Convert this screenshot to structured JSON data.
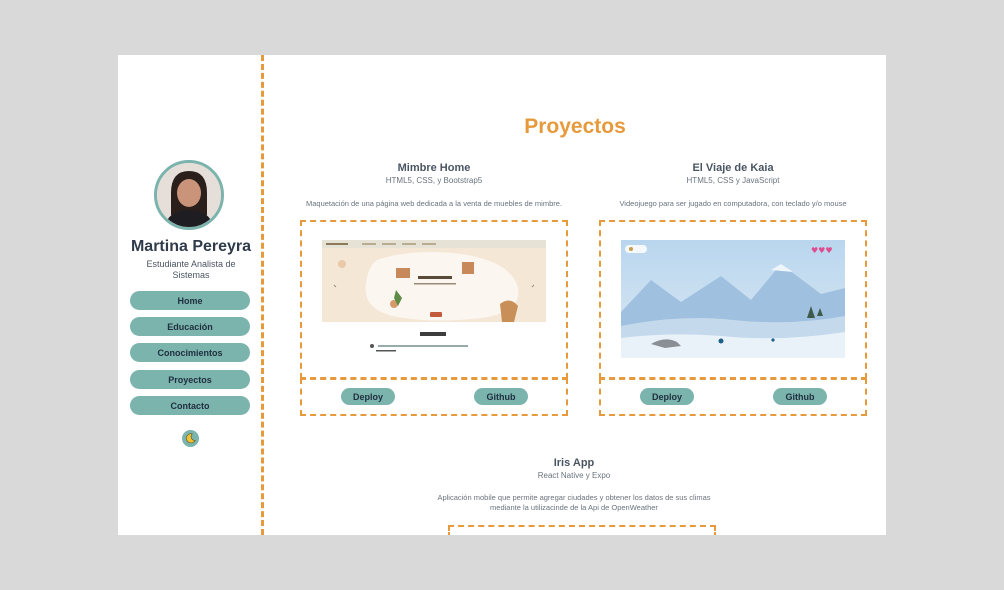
{
  "profile": {
    "name": "Martina Pereyra",
    "subtitle": "Estudiante Analista de Sistemas"
  },
  "nav": {
    "items": [
      "Home",
      "Educación",
      "Conocimientos",
      "Proyectos",
      "Contacto"
    ]
  },
  "theme_toggle": {
    "icon": "moon-icon"
  },
  "section": {
    "title": "Proyectos"
  },
  "projects": [
    {
      "title": "Mimbre Home",
      "tech": "HTML5, CSS, y Bootstrap5",
      "desc": "Maquetación de una página web dedicada a la venta de muebles de mimbre.",
      "preview": {
        "brand": "MIMBRE HOME",
        "heading": "Productos"
      },
      "deploy_label": "Deploy",
      "github_label": "Github"
    },
    {
      "title": "El Viaje de Kaia",
      "tech": "HTML5, CSS y JavaScript",
      "desc": "Videojuego para ser jugado en computadora, con teclado y/o mouse",
      "preview": {
        "lives": "♥♥♥"
      },
      "deploy_label": "Deploy",
      "github_label": "Github"
    },
    {
      "title": "Iris App",
      "tech": "React Native y Expo",
      "desc_line1": "Aplicación mobile que permite agregar ciudades y obtener los datos de sus climas",
      "desc_line2": "mediante la utilizacinde de la Api de OpenWeather"
    }
  ],
  "colors": {
    "accent": "#e69a3b",
    "button": "#7bb3ad",
    "background": "#d9d9d9"
  }
}
